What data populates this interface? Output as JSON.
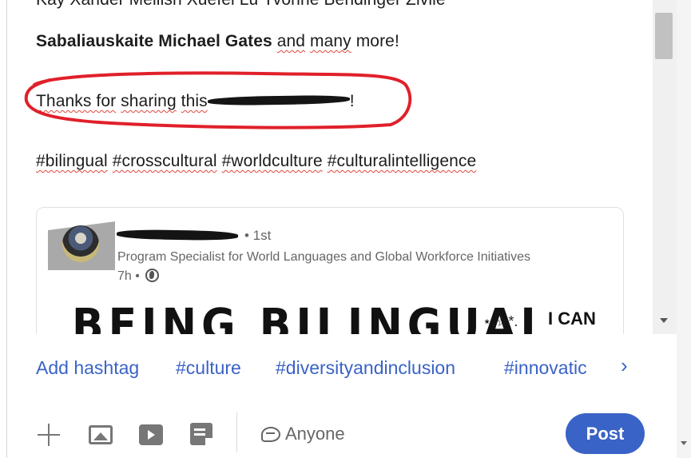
{
  "post": {
    "line1": "Kay Xander Mellish Xuefei Lu Yvonne Bendinger Zivile",
    "line2_name1": "Sabaliauskaite",
    "line2_name2": "Michael Gates",
    "line2_and": "and",
    "line2_many": "many",
    "line2_rest": "more!",
    "thanks_prefix": "Thanks for",
    "thanks_sharing": "sharing",
    "thanks_this": "this",
    "thanks_suffix": "!",
    "hashtags": [
      "#bilingual",
      "#crosscultural",
      "#worldculture",
      "#culturalintelligence"
    ]
  },
  "shared_card": {
    "connection": "• 1st",
    "headline": "Program Specialist for World Languages and Global Workforce Initiatives",
    "time": "7h •",
    "banner_text": "BEING BILINGUAL",
    "banner_right": "I CAN",
    "decoration": "⋆.☆*."
  },
  "hashtag_bar": {
    "add_label": "Add hashtag",
    "suggestions": [
      "#culture",
      "#diversityandinclusion",
      "#innovatic"
    ],
    "next": "›"
  },
  "toolbar": {
    "audience_label": "Anyone",
    "post_label": "Post"
  },
  "colors": {
    "accent": "#3a63c7",
    "annotation": "#e0202a",
    "text": "#1d1d1d",
    "muted": "#666666"
  }
}
